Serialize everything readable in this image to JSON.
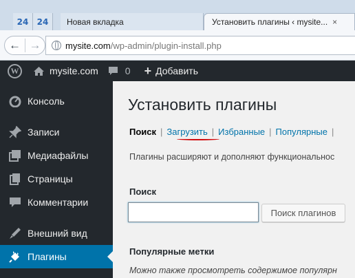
{
  "browser": {
    "pinned_tabs": [
      {
        "label": "24"
      },
      {
        "label": "24"
      }
    ],
    "tabs": [
      {
        "title": "Новая вкладка"
      },
      {
        "title": "Установить плагины ‹ mysite...",
        "close": "×"
      }
    ],
    "url_host": "mysite.com",
    "url_path": "/wp-admin/plugin-install.php"
  },
  "adminbar": {
    "site_name": "mysite.com",
    "comments_count": "0",
    "new_label": "Добавить"
  },
  "sidebar": {
    "items": [
      {
        "label": "Консоль",
        "icon": "dashboard-icon"
      },
      {
        "label": "Записи",
        "icon": "pin-icon"
      },
      {
        "label": "Медиафайлы",
        "icon": "media-icon"
      },
      {
        "label": "Страницы",
        "icon": "pages-icon"
      },
      {
        "label": "Комментарии",
        "icon": "comments-icon"
      },
      {
        "label": "Внешний вид",
        "icon": "appearance-icon"
      },
      {
        "label": "Плагины",
        "icon": "plugins-icon"
      }
    ]
  },
  "main": {
    "title": "Установить плагины",
    "subnav": {
      "search": "Поиск",
      "upload": "Загрузить",
      "featured": "Избранные",
      "popular": "Популярные",
      "separator": "|"
    },
    "description": "Плагины расширяют и дополняют функциональнос",
    "search_label": "Поиск",
    "search_value": "",
    "search_button": "Поиск плагинов",
    "tags_heading": "Популярные метки",
    "tags_description": "Можно также просмотреть содержимое популярн"
  },
  "colors": {
    "admin_bar_bg": "#23282d",
    "accent": "#0073aa",
    "annotation_red": "#d10d10"
  }
}
